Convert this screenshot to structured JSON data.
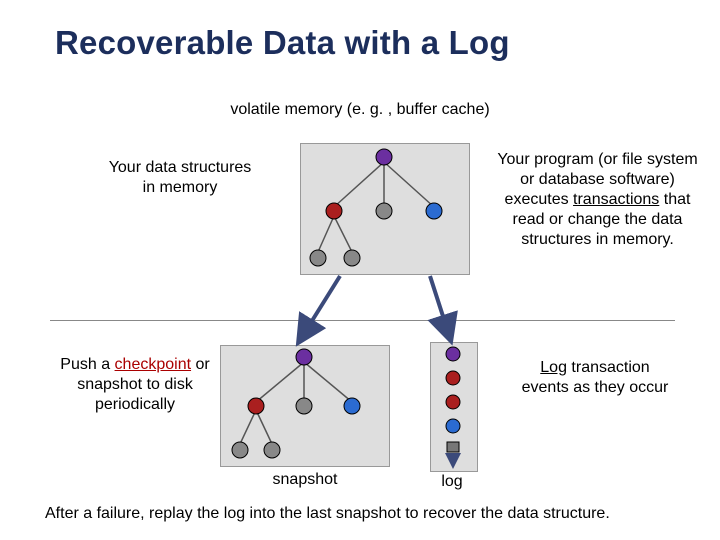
{
  "title": "Recoverable Data with a Log",
  "labels": {
    "volatile": "volatile memory (e. g. , buffer cache)",
    "left1a": "Your data structures",
    "left1b": "in memory",
    "right1a": "Your program (or file system",
    "right1b": "or database software)",
    "right1c_a": "executes ",
    "right1c_b": "transactions",
    "right1c_c": " that",
    "right1d": "read or change the data",
    "right1e": "structures in memory.",
    "left2a": "Push a ",
    "left2b": "checkpoint",
    "left2c": " or",
    "left2d": "snapshot to disk",
    "left2e": "periodically",
    "right2a": "Log",
    "right2b": " transaction",
    "right2c": "events as they occur",
    "snapshot": "snapshot",
    "log": "log",
    "bottom": "After a failure, replay the log into the last snapshot to recover the data structure."
  },
  "chart_data": {
    "type": "tree",
    "title": "Recoverable Data with a Log",
    "nodes_top": [
      {
        "id": "t1",
        "color": "purple",
        "children": [
          "t2",
          "t3",
          "t4"
        ]
      },
      {
        "id": "t2",
        "color": "red",
        "children": [
          "t5",
          "t6"
        ]
      },
      {
        "id": "t3",
        "color": "gray"
      },
      {
        "id": "t4",
        "color": "blue"
      },
      {
        "id": "t5",
        "color": "gray"
      },
      {
        "id": "t6",
        "color": "gray"
      }
    ],
    "nodes_bottom": [
      {
        "id": "b1",
        "color": "purple",
        "children": [
          "b2",
          "b3",
          "b4"
        ]
      },
      {
        "id": "b2",
        "color": "red",
        "children": [
          "b5",
          "b6"
        ]
      },
      {
        "id": "b3",
        "color": "gray"
      },
      {
        "id": "b4",
        "color": "blue"
      },
      {
        "id": "b5",
        "color": "gray"
      },
      {
        "id": "b6",
        "color": "gray"
      }
    ],
    "log_nodes": [
      {
        "color": "purple"
      },
      {
        "color": "red"
      },
      {
        "color": "red"
      },
      {
        "color": "blue"
      },
      {
        "color": "sq-gray"
      }
    ],
    "arrows": [
      {
        "from": "box_top_left",
        "to": "box_bot"
      },
      {
        "from": "box_top_right",
        "to": "box_log"
      },
      {
        "from": "log_last",
        "to": "log_down"
      }
    ]
  }
}
